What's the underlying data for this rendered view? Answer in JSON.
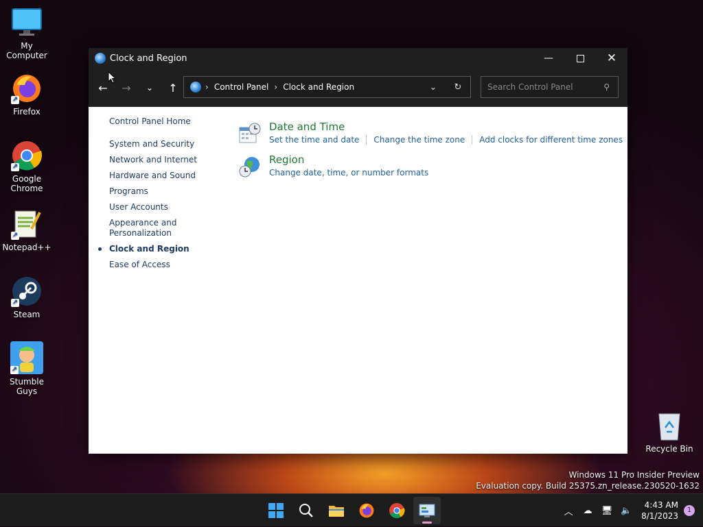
{
  "desktop": {
    "icons": [
      {
        "label": "My Computer"
      },
      {
        "label": "Firefox"
      },
      {
        "label": "Google Chrome"
      },
      {
        "label": "Notepad++"
      },
      {
        "label": "Steam"
      },
      {
        "label": "Stumble Guys"
      },
      {
        "label": "Recycle Bin"
      }
    ],
    "watermark": {
      "line1": "Windows 11 Pro Insider Preview",
      "line2": "Evaluation copy. Build 25375.zn_release.230520-1632"
    }
  },
  "window": {
    "title": "Clock and Region",
    "breadcrumb": [
      "Control Panel",
      "Clock and Region"
    ],
    "search_placeholder": "Search Control Panel"
  },
  "sidebar": {
    "home": "Control Panel Home",
    "items": [
      "System and Security",
      "Network and Internet",
      "Hardware and Sound",
      "Programs",
      "User Accounts",
      "Appearance and Personalization",
      "Clock and Region",
      "Ease of Access"
    ],
    "current": "Clock and Region"
  },
  "main": {
    "categories": [
      {
        "title": "Date and Time",
        "links": [
          "Set the time and date",
          "Change the time zone",
          "Add clocks for different time zones"
        ]
      },
      {
        "title": "Region",
        "links": [
          "Change date, time, or number formats"
        ]
      }
    ]
  },
  "taskbar": {
    "time": "4:43 AM",
    "date": "8/1/2023",
    "notification_count": "1"
  },
  "colors": {
    "link": "#1f5f9e",
    "category_title": "#1e7a34",
    "titlebar": "#1f1f1f"
  }
}
